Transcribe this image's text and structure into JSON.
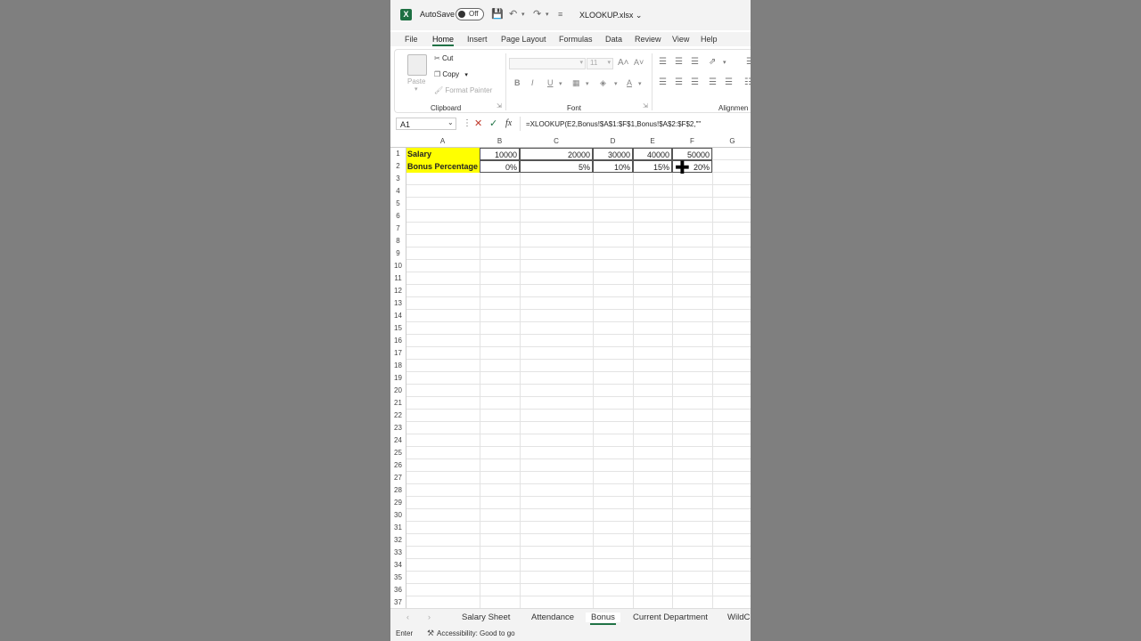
{
  "titlebar": {
    "logo_letter": "X",
    "autosave_label": "AutoSave",
    "autosave_state": "Off",
    "file_name": "XLOOKUP.xlsx",
    "icons": [
      "save-icon",
      "undo-icon",
      "redo-icon",
      "customize-icon"
    ]
  },
  "menu": {
    "tabs": [
      "File",
      "Home",
      "Insert",
      "Page Layout",
      "Formulas",
      "Data",
      "Review",
      "View",
      "Help"
    ],
    "active": "Home"
  },
  "ribbon": {
    "clipboard": {
      "paste": "Paste",
      "cut": "Cut",
      "copy": "Copy",
      "format_painter": "Format Painter",
      "group_label": "Clipboard"
    },
    "font": {
      "font_size": "11",
      "group_label": "Font",
      "bold": "B",
      "italic": "I",
      "underline": "U",
      "grow": "A˄",
      "shrink": "A˅",
      "font_color": "A"
    },
    "alignment": {
      "group_label": "Alignmen"
    }
  },
  "formula_bar": {
    "name_box": "A1",
    "formula": "=XLOOKUP(E2,Bonus!$A$1:$F$1,Bonus!$A$2:$F$2,\"\""
  },
  "sheet": {
    "columns": [
      "A",
      "B",
      "C",
      "D",
      "E",
      "F",
      "G"
    ],
    "rows": [
      "1",
      "2",
      "3",
      "4",
      "5",
      "6",
      "7",
      "8",
      "9",
      "10",
      "11",
      "12",
      "13",
      "14",
      "15",
      "16",
      "17",
      "18",
      "19",
      "20",
      "21",
      "22",
      "23",
      "24",
      "25",
      "26",
      "27",
      "28",
      "29",
      "30",
      "31",
      "32",
      "33",
      "34",
      "35",
      "36",
      "37"
    ],
    "row1": {
      "label": "Salary",
      "values": [
        "10000",
        "20000",
        "30000",
        "40000",
        "50000"
      ]
    },
    "row2": {
      "label": "Bonus Percentage",
      "values": [
        "0%",
        "5%",
        "10%",
        "15%",
        "20%"
      ]
    },
    "highlight_color": "#ffff00"
  },
  "sheet_tabs": {
    "tabs": [
      "Salary Sheet",
      "Attendance",
      "Bonus",
      "Current Department",
      "WildC"
    ],
    "active": "Bonus"
  },
  "status": {
    "mode": "Enter",
    "accessibility": "Accessibility: Good to go"
  }
}
